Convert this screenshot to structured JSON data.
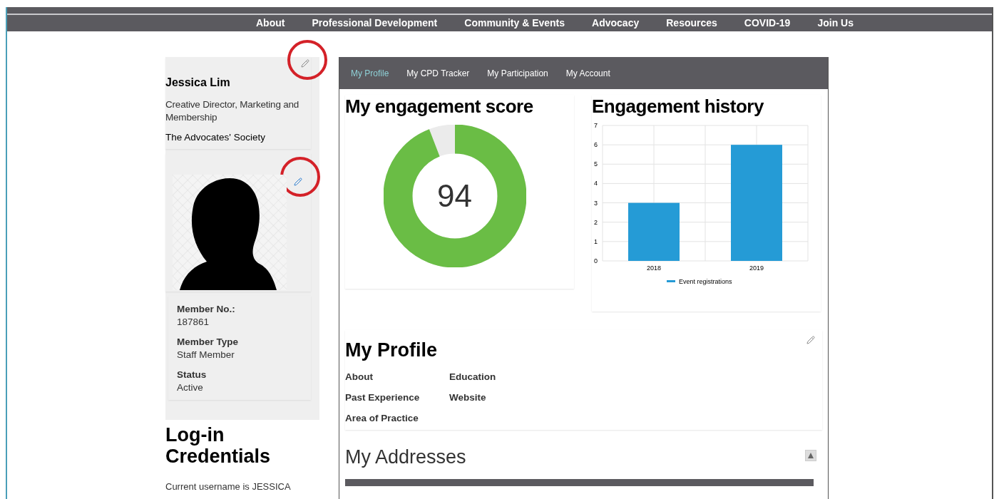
{
  "nav": {
    "items": [
      "About",
      "Professional Development",
      "Community & Events",
      "Advocacy",
      "Resources",
      "COVID-19",
      "Join Us"
    ]
  },
  "sidebar": {
    "name": "Jessica Lim",
    "title": "Creative Director, Marketing and Membership",
    "organization": "The Advocates' Society",
    "details": [
      {
        "label": "Member No.:",
        "value": "187861"
      },
      {
        "label": "Member Type",
        "value": "Staff Member"
      },
      {
        "label": "Status",
        "value": "Active"
      }
    ],
    "credentials": {
      "heading": "Log-in Credentials",
      "text": "Current username is  JESSICA"
    }
  },
  "tabs": [
    {
      "label": "My Profile",
      "selected": true
    },
    {
      "label": "My CPD Tracker",
      "selected": false
    },
    {
      "label": "My Participation",
      "selected": false
    },
    {
      "label": "My Account",
      "selected": false
    }
  ],
  "score": {
    "heading": "My engagement score",
    "value": "94"
  },
  "history": {
    "heading": "Engagement history",
    "chart_data": {
      "type": "bar",
      "categories": [
        "2018",
        "2019"
      ],
      "series": [
        {
          "name": "Event registrations",
          "color": "#259bd6",
          "values": [
            3,
            6
          ]
        }
      ],
      "ylim": [
        0,
        7
      ],
      "yticks": [
        0,
        1,
        2,
        3,
        4,
        5,
        6,
        7
      ],
      "grid": true
    }
  },
  "profile": {
    "heading": "My Profile",
    "fields": [
      [
        "About",
        "Past Experience",
        "Area of Practice"
      ],
      [
        "Education",
        "Website"
      ]
    ]
  },
  "addresses": {
    "heading": "My Addresses"
  }
}
